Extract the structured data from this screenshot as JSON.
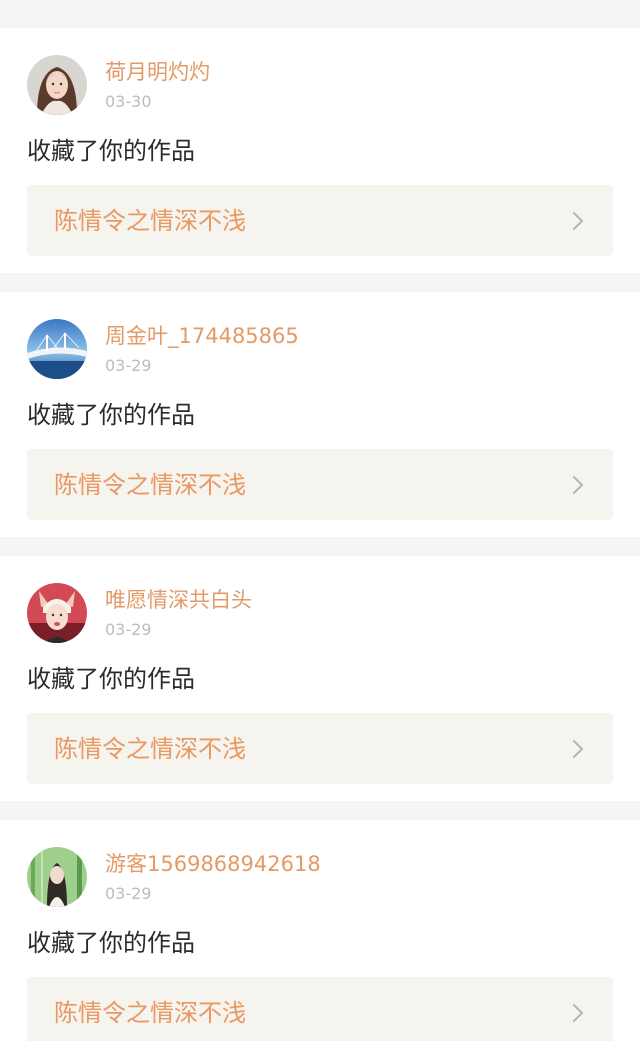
{
  "notifications": [
    {
      "username": "荷月明灼灼",
      "date": "03-30",
      "action": "收藏了你的作品",
      "work_title": "陈情令之情深不浅",
      "avatar_icon": "girl-portrait-avatar"
    },
    {
      "username": "周金叶_174485865",
      "date": "03-29",
      "action": "收藏了你的作品",
      "work_title": "陈情令之情深不浅",
      "avatar_icon": "bridge-landscape-avatar"
    },
    {
      "username": "唯愿情深共白头",
      "date": "03-29",
      "action": "收藏了你的作品",
      "work_title": "陈情令之情深不浅",
      "avatar_icon": "boy-with-ears-avatar"
    },
    {
      "username": "游客1569868942618",
      "date": "03-29",
      "action": "收藏了你的作品",
      "work_title": "陈情令之情深不浅",
      "avatar_icon": "girl-in-forest-avatar"
    }
  ],
  "colors": {
    "username": "#e39a66",
    "date": "#bcbcbc",
    "action": "#2b2b2b",
    "work_title": "#eb9760",
    "work_background": "#f5f4ef",
    "page_background": "#f6f5f4"
  }
}
